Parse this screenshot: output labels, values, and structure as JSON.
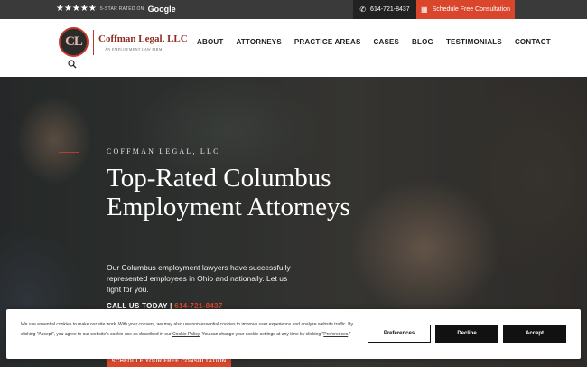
{
  "topbar": {
    "stars": "★★★★★",
    "rated_text": "5-STAR RATED ON",
    "google": "Google",
    "phone": "614-721-8437",
    "consult": "Schedule Free Consultation",
    "icons": {
      "phone": "phone-icon",
      "calendar": "calendar-icon"
    }
  },
  "header": {
    "logo_initials": "CL",
    "logo_name": "Coffman Legal, LLC",
    "logo_tagline": "AN EMPLOYMENT LAW FIRM",
    "nav": [
      "ABOUT",
      "ATTORNEYS",
      "PRACTICE AREAS",
      "CASES",
      "BLOG",
      "TESTIMONIALS",
      "CONTACT"
    ]
  },
  "hero": {
    "eyebrow": "COFFMAN LEGAL, LLC",
    "headline": "Top-Rated Columbus Employment Attorneys",
    "subtext": "Our Columbus employment lawyers have successfully represented employees in Ohio and nationally. Let us fight for you.",
    "call_label": "CALL US TODAY |",
    "call_number": "614-721-8437",
    "cta": "SCHEDULE YOUR FREE CONSULTATION"
  },
  "cookie": {
    "text_before": "We use essential cookies to make our site work. With your consent, we may also use non-essential cookies to improve user experience and analyze website traffic. By clicking \"Accept\", you agree to our website's cookie use as described in our ",
    "cookie_policy_link": "Cookie Policy",
    "text_middle": ". You can change your cookie settings at any time by clicking \"",
    "preferences_link": "Preferences",
    "text_after": ".\"",
    "btn_preferences": "Preferences",
    "btn_decline": "Decline",
    "btn_accept": "Accept"
  },
  "colors": {
    "accent": "#d9462b",
    "brand_dark": "#8e2b21",
    "topbar": "#3a3a3a"
  }
}
